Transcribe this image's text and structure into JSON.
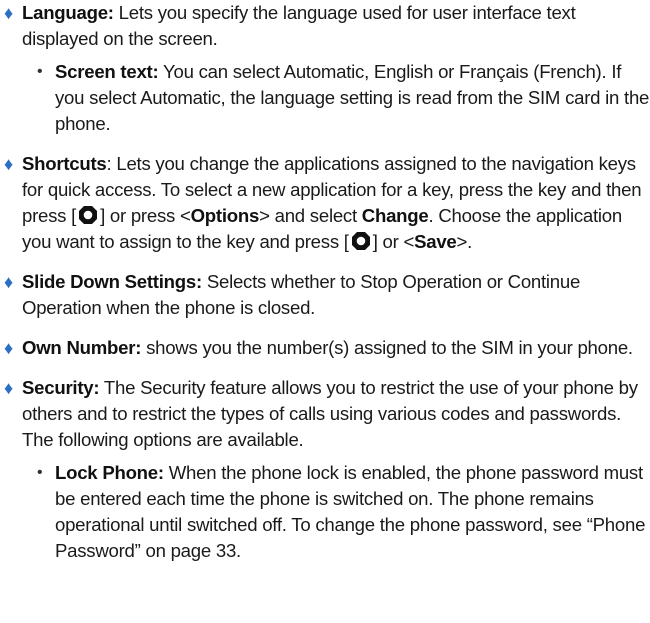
{
  "items": {
    "language": {
      "title": "Language:",
      "text": " Lets you specify the language used for user interface text displayed on the screen.",
      "sub": {
        "title": "Screen text:",
        "text": " You can select Automatic, English or Français (French). If you select Automatic, the language setting is read from the SIM card in the phone."
      }
    },
    "shortcuts": {
      "title": "Shortcuts",
      "t1": ": Lets you change the applications assigned to the navigation keys for quick access. To select a new application for a key, press the key and then press [",
      "t2": "] or press <",
      "options": "Options",
      "t3": "> and select ",
      "change": "Change",
      "t4": ". Choose the application you want to assign to the key and press [",
      "t5": "] or <",
      "save": "Save",
      "t6": ">."
    },
    "slide": {
      "title": "Slide Down Settings:",
      "text": " Selects whether to Stop Operation or Continue Operation when the phone is closed."
    },
    "own": {
      "title": "Own Number:",
      "text": " shows you the number(s) assigned to the SIM in your phone."
    },
    "security": {
      "title": "Security:",
      "text": " The Security feature allows you to restrict the use of your phone by others and to restrict the types of calls using various codes and passwords. The following options are available.",
      "sub": {
        "title": "Lock Phone:",
        "text": " When the phone lock is enabled, the phone password must be entered each time the phone is switched on. The phone remains operational until switched off. To change the phone password, see “Phone Password” on page 33."
      }
    }
  },
  "glyphs": {
    "diamond": "♦",
    "dot": "•"
  },
  "colors": {
    "bullet": "#2a6fc4"
  }
}
